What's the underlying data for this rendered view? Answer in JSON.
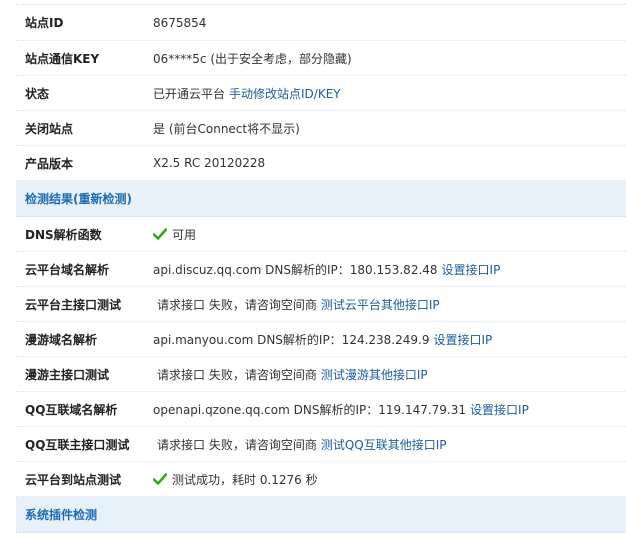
{
  "basic": [
    {
      "label": "站点ID",
      "value": "8675854"
    },
    {
      "label": "站点通信KEY",
      "value": "06****5c (出于安全考虑，部分隐藏)"
    },
    {
      "label": "状态",
      "value": "已开通云平台",
      "link": "手动修改站点ID/KEY"
    },
    {
      "label": "关闭站点",
      "value": "是 (前台Connect将不显示)"
    },
    {
      "label": "产品版本",
      "value": "X2.5 RC 20120228"
    }
  ],
  "check_section": {
    "title_prefix": "检测结果(",
    "title_link": "重新检测",
    "title_suffix": ")"
  },
  "checks": [
    {
      "label": "DNS解析函数",
      "status_text": "可用"
    },
    {
      "label": "云平台域名解析",
      "value": "api.discuz.qq.com DNS解析的IP：180.153.82.48",
      "link": "设置接口IP"
    },
    {
      "label": "云平台主接口测试",
      "value": "请求接口 失败，请咨询空间商",
      "link": "测试云平台其他接口IP"
    },
    {
      "label": "漫游域名解析",
      "value": "api.manyou.com DNS解析的IP：124.238.249.9",
      "link": "设置接口IP"
    },
    {
      "label": "漫游主接口测试",
      "value": "请求接口 失败，请咨询空间商",
      "link": "测试漫游其他接口IP"
    },
    {
      "label": "QQ互联域名解析",
      "value": "openapi.qzone.qq.com DNS解析的IP：119.147.79.31",
      "link": "设置接口IP"
    },
    {
      "label": "QQ互联主接口测试",
      "value": "请求接口 失败，请咨询空间商",
      "link": "测试QQ互联其他接口IP"
    },
    {
      "label": "云平台到站点测试",
      "status_text": "测试成功，耗时 0.1276 秒"
    }
  ],
  "plugin_section": {
    "title": "系统插件检测"
  },
  "colors": {
    "link": "#1d5c9a",
    "section_bg": "#e8f1f9",
    "section_text": "#1d6cb3",
    "check_green": "#3aa31f"
  }
}
